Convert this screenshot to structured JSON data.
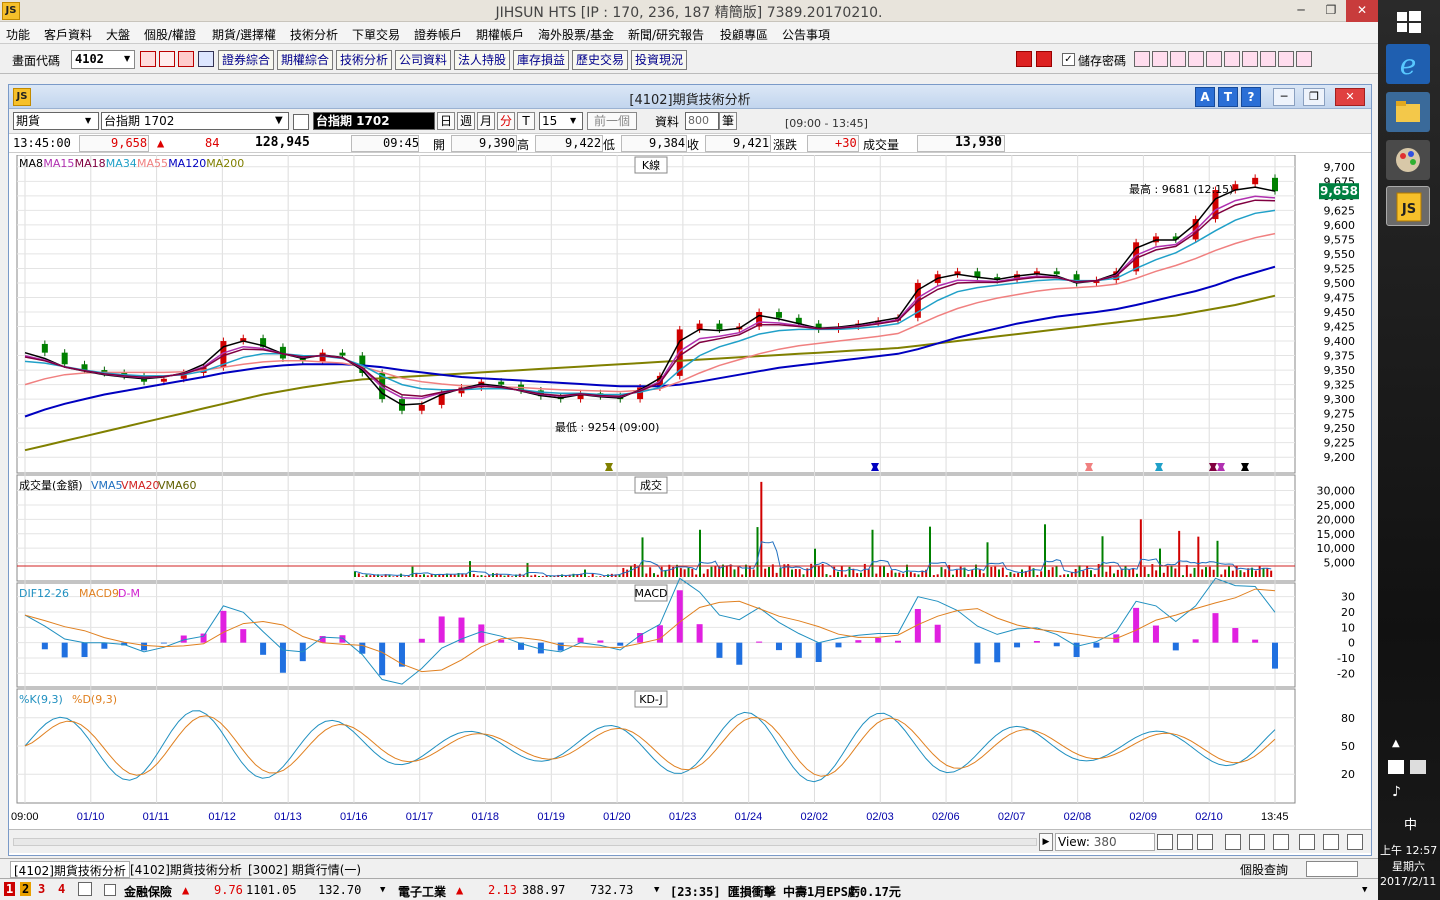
{
  "app": {
    "title": "JIHSUN HTS     [IP : 170, 236, 187 精簡版] 7389.20170210.",
    "logo": "JS",
    "win_buttons": [
      "─",
      "❐",
      "✕"
    ]
  },
  "menu": [
    "功能",
    "客戶資料",
    "大盤",
    "個股/權證",
    "期貨/選擇權",
    "技術分析",
    "下單交易",
    "證券帳戶",
    "期權帳戶",
    "海外股票/基金",
    "新聞/研究報告",
    "投顧專區",
    "公告事項"
  ],
  "toolbar": {
    "code_label": "畫面代碼",
    "code_value": "4102",
    "buttons": [
      "證券綜合",
      "期權綜合",
      "技術分析",
      "公司資料",
      "法人持股",
      "庫存損益",
      "歷史交易",
      "投資現況"
    ],
    "save_pwd_label": "儲存密碼",
    "save_pwd_checked": true
  },
  "child": {
    "title": "[4102]期貨技術分析",
    "help_buttons": [
      "A",
      "T",
      "?"
    ],
    "controls": {
      "type_value": "期貨",
      "symbol_value": "台指期 1702",
      "symbol_display": "台指期 1702",
      "periods": [
        "日",
        "週",
        "月",
        "分",
        "T"
      ],
      "active_period": "分",
      "minutes_value": "15",
      "prev_label": "前一個",
      "data_label": "資料",
      "data_count": "800",
      "data_unit": "筆",
      "session": "[09:00 - 13:45]"
    },
    "quote": {
      "time": "13:45:00",
      "price": "9,658",
      "change": "84",
      "volume": "128,945",
      "bar_time": "09:45",
      "open_label": "開",
      "open": "9,390",
      "high_label": "高",
      "high": "9,422",
      "low_label": "低",
      "low": "9,384",
      "close_label": "收",
      "close": "9,421",
      "chg_label": "漲跌",
      "chg": "+30",
      "vol_label": "成交量",
      "vol": "13,930"
    },
    "bottom": {
      "view_label": "View:",
      "view_value": "380"
    }
  },
  "chart_data": {
    "type": "line",
    "title": "K線",
    "ma_legend": [
      {
        "name": "MA8",
        "color": "#000000"
      },
      {
        "name": "MA15",
        "color": "#b030b0"
      },
      {
        "name": "MA18",
        "color": "#800040"
      },
      {
        "name": "MA34",
        "color": "#20a0c8"
      },
      {
        "name": "MA55",
        "color": "#f08080"
      },
      {
        "name": "MA120",
        "color": "#0000c0"
      },
      {
        "name": "MA200",
        "color": "#808000"
      }
    ],
    "x_labels": [
      "09:00",
      "01/10",
      "01/11",
      "01/12",
      "01/13",
      "01/16",
      "01/17",
      "01/18",
      "01/19",
      "01/20",
      "01/23",
      "01/24",
      "02/02",
      "02/03",
      "02/06",
      "02/07",
      "02/08",
      "02/09",
      "02/10",
      "13:45"
    ],
    "y_ticks": [
      9200,
      9225,
      9250,
      9275,
      9300,
      9325,
      9350,
      9375,
      9400,
      9425,
      9450,
      9475,
      9500,
      9525,
      9550,
      9575,
      9600,
      9625,
      9650,
      9675,
      9700
    ],
    "ylim": [
      9190,
      9710
    ],
    "price_tag": "9,658",
    "high_note": "最高 : 9681 (12:15)",
    "low_note": "最低 : 9254 (09:00)",
    "price_path": [
      9395,
      9380,
      9360,
      9350,
      9345,
      9340,
      9330,
      9335,
      9345,
      9355,
      9400,
      9405,
      9390,
      9370,
      9365,
      9380,
      9375,
      9345,
      9300,
      9280,
      9290,
      9310,
      9320,
      9330,
      9325,
      9315,
      9305,
      9300,
      9310,
      9305,
      9300,
      9320,
      9340,
      9420,
      9430,
      9420,
      9425,
      9450,
      9440,
      9430,
      9420,
      9425,
      9430,
      9435,
      9440,
      9500,
      9515,
      9520,
      9510,
      9505,
      9515,
      9520,
      9515,
      9500,
      9505,
      9520,
      9570,
      9580,
      9575,
      9610,
      9660,
      9670,
      9681,
      9658
    ],
    "ma8_pts": [
      9380,
      9370,
      9355,
      9348,
      9342,
      9338,
      9335,
      9338,
      9345,
      9360,
      9390,
      9400,
      9392,
      9378,
      9370,
      9376,
      9372,
      9350,
      9310,
      9290,
      9292,
      9308,
      9318,
      9326,
      9322,
      9314,
      9306,
      9302,
      9308,
      9304,
      9302,
      9316,
      9336,
      9400,
      9420,
      9418,
      9422,
      9444,
      9438,
      9430,
      9422,
      9424,
      9428,
      9434,
      9440,
      9488,
      9508,
      9515,
      9510,
      9506,
      9512,
      9516,
      9512,
      9500,
      9504,
      9516,
      9560,
      9574,
      9574,
      9602,
      9645,
      9660,
      9665,
      9658
    ],
    "ma34_pts": [
      9365,
      9362,
      9356,
      9350,
      9345,
      9342,
      9340,
      9340,
      9342,
      9348,
      9360,
      9372,
      9378,
      9378,
      9375,
      9374,
      9370,
      9358,
      9340,
      9325,
      9318,
      9316,
      9316,
      9318,
      9318,
      9316,
      9312,
      9310,
      9310,
      9308,
      9308,
      9312,
      9320,
      9350,
      9375,
      9390,
      9400,
      9412,
      9418,
      9420,
      9420,
      9420,
      9422,
      9425,
      9430,
      9450,
      9470,
      9485,
      9492,
      9496,
      9500,
      9504,
      9506,
      9504,
      9504,
      9508,
      9525,
      9540,
      9552,
      9570,
      9590,
      9608,
      9620,
      9625
    ],
    "ma55_pts": [
      9325,
      9335,
      9342,
      9345,
      9346,
      9346,
      9346,
      9346,
      9347,
      9350,
      9355,
      9360,
      9364,
      9366,
      9366,
      9364,
      9362,
      9356,
      9346,
      9336,
      9330,
      9326,
      9323,
      9322,
      9321,
      9320,
      9318,
      9316,
      9315,
      9314,
      9313,
      9315,
      9318,
      9330,
      9345,
      9358,
      9368,
      9378,
      9386,
      9392,
      9396,
      9400,
      9404,
      9408,
      9413,
      9428,
      9443,
      9456,
      9466,
      9474,
      9480,
      9486,
      9490,
      9492,
      9494,
      9498,
      9508,
      9520,
      9530,
      9542,
      9556,
      9568,
      9578,
      9585
    ],
    "ma120_pts": [
      9270,
      9282,
      9292,
      9300,
      9308,
      9314,
      9320,
      9326,
      9332,
      9338,
      9345,
      9350,
      9355,
      9358,
      9360,
      9360,
      9360,
      9358,
      9355,
      9350,
      9346,
      9342,
      9338,
      9336,
      9334,
      9332,
      9330,
      9328,
      9326,
      9324,
      9322,
      9322,
      9322,
      9325,
      9330,
      9336,
      9342,
      9348,
      9354,
      9358,
      9362,
      9366,
      9370,
      9374,
      9378,
      9386,
      9396,
      9406,
      9414,
      9422,
      9430,
      9436,
      9442,
      9446,
      9450,
      9455,
      9462,
      9470,
      9478,
      9486,
      9496,
      9508,
      9518,
      9528
    ],
    "ma200_pts": [
      9212,
      9220,
      9228,
      9236,
      9244,
      9252,
      9260,
      9268,
      9276,
      9284,
      9292,
      9300,
      9308,
      9314,
      9320,
      9325,
      9330,
      9334,
      9336,
      9338,
      9340,
      9342,
      9344,
      9346,
      9348,
      9350,
      9352,
      9354,
      9356,
      9358,
      9360,
      9362,
      9364,
      9366,
      9368,
      9370,
      9372,
      9374,
      9376,
      9378,
      9380,
      9382,
      9384,
      9386,
      9388,
      9392,
      9396,
      9400,
      9404,
      9408,
      9412,
      9416,
      9420,
      9424,
      9428,
      9432,
      9436,
      9440,
      9444,
      9450,
      9456,
      9462,
      9470,
      9478
    ],
    "volume_panel": {
      "title": "成交",
      "legend": [
        {
          "name": "成交量(金額)",
          "color": "#000000"
        },
        {
          "name": "VMA5",
          "color": "#2070c0"
        },
        {
          "name": "VMA20",
          "color": "#d02020"
        },
        {
          "name": "VMA60",
          "color": "#606000"
        }
      ],
      "y_ticks": [
        5000,
        10000,
        15000,
        20000,
        25000,
        30000
      ],
      "ymax": 34000
    },
    "macd_panel": {
      "title": "MACD",
      "legend": [
        {
          "name": "DIF12-26",
          "color": "#2090c0"
        },
        {
          "name": "MACD9",
          "color": "#e08020"
        },
        {
          "name": "D-M",
          "color": "#d020d0"
        }
      ],
      "y_ticks": [
        30,
        20,
        10,
        0,
        -10,
        -20
      ],
      "ylim": [
        -25,
        35
      ]
    },
    "kd_panel": {
      "title": "KD-J",
      "legend": [
        {
          "name": "%K(9,3)",
          "color": "#2090c0"
        },
        {
          "name": "%D(9,3)",
          "color": "#e08020"
        }
      ],
      "y_ticks": [
        80,
        50,
        20
      ],
      "ylim": [
        0,
        100
      ]
    },
    "grid": true
  },
  "bottom_tabs": [
    "[4102]期貨技術分析",
    "[4102]期貨技術分析",
    "[3002] 期貨行情(一)"
  ],
  "status_bar": {
    "pages": [
      "1",
      "2",
      "3",
      "4"
    ],
    "sector1": "金融保險",
    "sector1_chg": "9.76",
    "sector1_idx": "1101.05",
    "sector1_vol": "132.70",
    "sector2": "電子工業",
    "sector2_chg": "2.13",
    "sector2_idx": "388.97",
    "sector2_vol": "732.73",
    "news": "[23:35] 匯損衝擊 中壽1月EPS虧0.17元",
    "stock_query": "個股查詢"
  },
  "taskbar": {
    "time": "上午 12:57",
    "weekday": "星期六",
    "date": "2017/2/11",
    "ime": "中"
  }
}
